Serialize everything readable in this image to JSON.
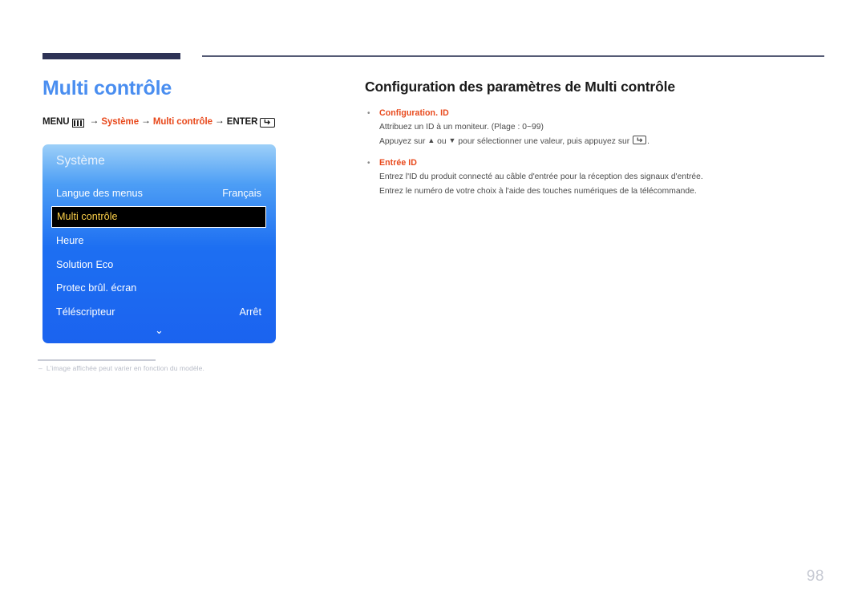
{
  "page_title": "Multi contrôle",
  "breadcrumb": {
    "menu_label": "MENU",
    "menu_icon": "menu-grid-icon",
    "arrow": "→",
    "step1": "Système",
    "step2": "Multi contrôle",
    "enter_label": "ENTER",
    "enter_icon": "enter-key-icon"
  },
  "osd": {
    "title": "Système",
    "rows": [
      {
        "label": "Langue des menus",
        "value": "Français",
        "selected": false
      },
      {
        "label": "Multi contrôle",
        "value": "",
        "selected": true
      },
      {
        "label": "Heure",
        "value": "",
        "selected": false
      },
      {
        "label": "Solution Eco",
        "value": "",
        "selected": false
      },
      {
        "label": "Protec brûl. écran",
        "value": "",
        "selected": false
      },
      {
        "label": "Téléscripteur",
        "value": "Arrêt",
        "selected": false
      }
    ],
    "scroll_indicator": "⌄"
  },
  "footnote": {
    "dash": "‒",
    "text": "L'image affichée peut varier en fonction du modèle."
  },
  "section": {
    "title": "Configuration des paramètres de Multi contrôle",
    "bullet_char": "•",
    "groups": [
      {
        "heading": "Configuration. ID",
        "lines_pre": "Attribuez un ID à un moniteur. (Plage : 0~99)",
        "line2_a": "Appuyez sur ",
        "line2_up": "▲",
        "line2_b": " ou ",
        "line2_down": "▼",
        "line2_c": " pour sélectionner une valeur, puis appuyez sur ",
        "line2_d": "."
      },
      {
        "heading": "Entrée ID",
        "line1": "Entrez l'ID du produit connecté au câble d'entrée pour la réception des signaux d'entrée.",
        "line2": "Entrez le numéro de votre choix à l'aide des touches numériques de la télécommande."
      }
    ]
  },
  "page_number": "98",
  "colors": {
    "title_blue": "#4a8ef0",
    "accent_red": "#e8491c",
    "rule_navy": "#2e3356",
    "osd_blue": "#1d6ff2",
    "selected_text": "#ffd24a"
  }
}
